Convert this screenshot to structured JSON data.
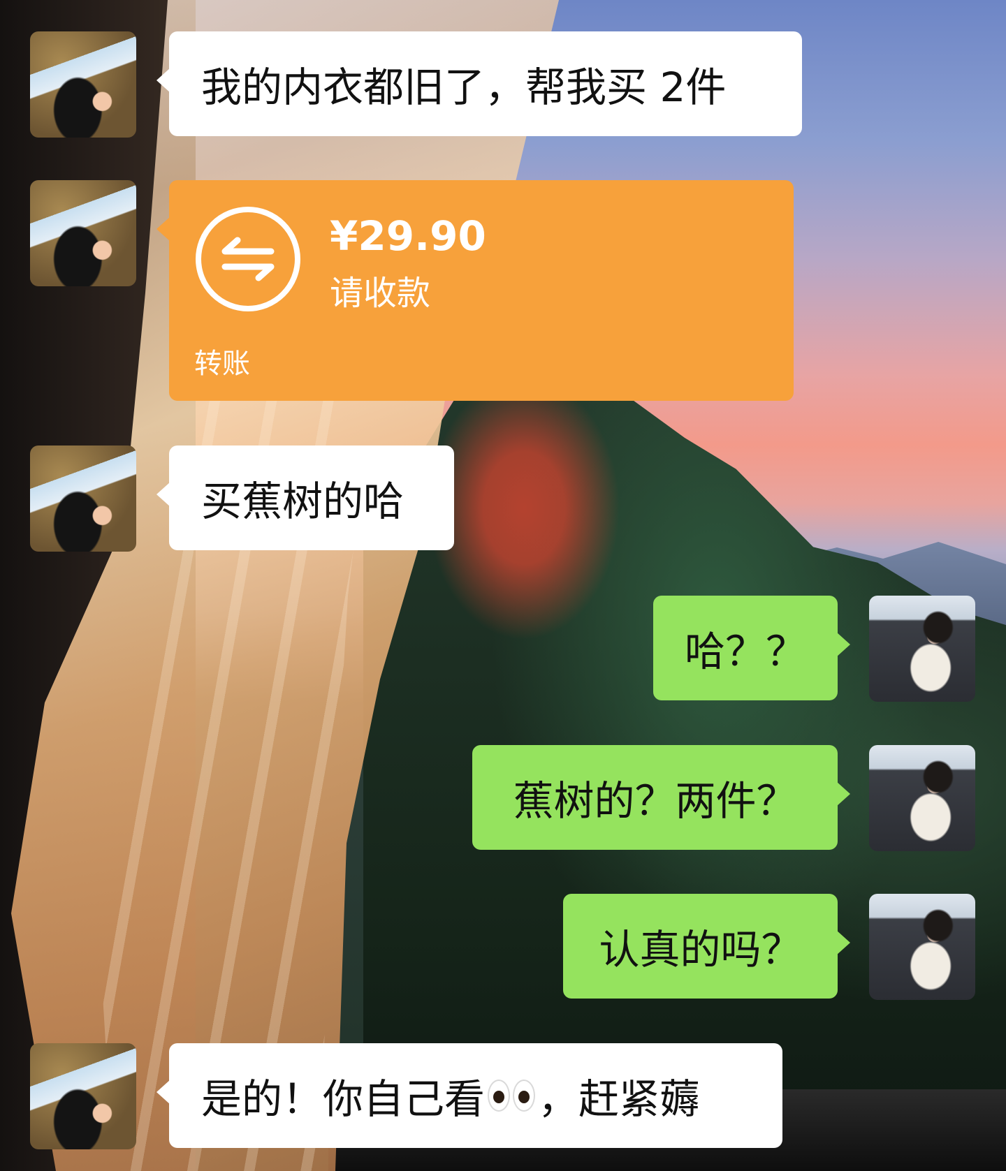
{
  "chat": {
    "messages": [
      {
        "side": "left",
        "type": "text",
        "text": "我的内衣都旧了，帮我买 2件"
      },
      {
        "side": "left",
        "type": "transfer",
        "amount": "¥29.90",
        "status": "请收款",
        "card_label": "转账"
      },
      {
        "side": "left",
        "type": "text",
        "text": "买蕉树的哈"
      },
      {
        "side": "right",
        "type": "text",
        "text": "哈？？"
      },
      {
        "side": "right",
        "type": "text",
        "text": "蕉树的？两件？"
      },
      {
        "side": "right",
        "type": "text",
        "text": "认真的吗？"
      },
      {
        "side": "left",
        "type": "text",
        "text_before": "是的！你自己看",
        "emoji": "eyes-icon",
        "text_after": "，赶紧薅"
      }
    ]
  },
  "colors": {
    "incoming_bubble": "#ffffff",
    "outgoing_bubble": "#95e35e",
    "transfer_card": "#f7a13b"
  }
}
